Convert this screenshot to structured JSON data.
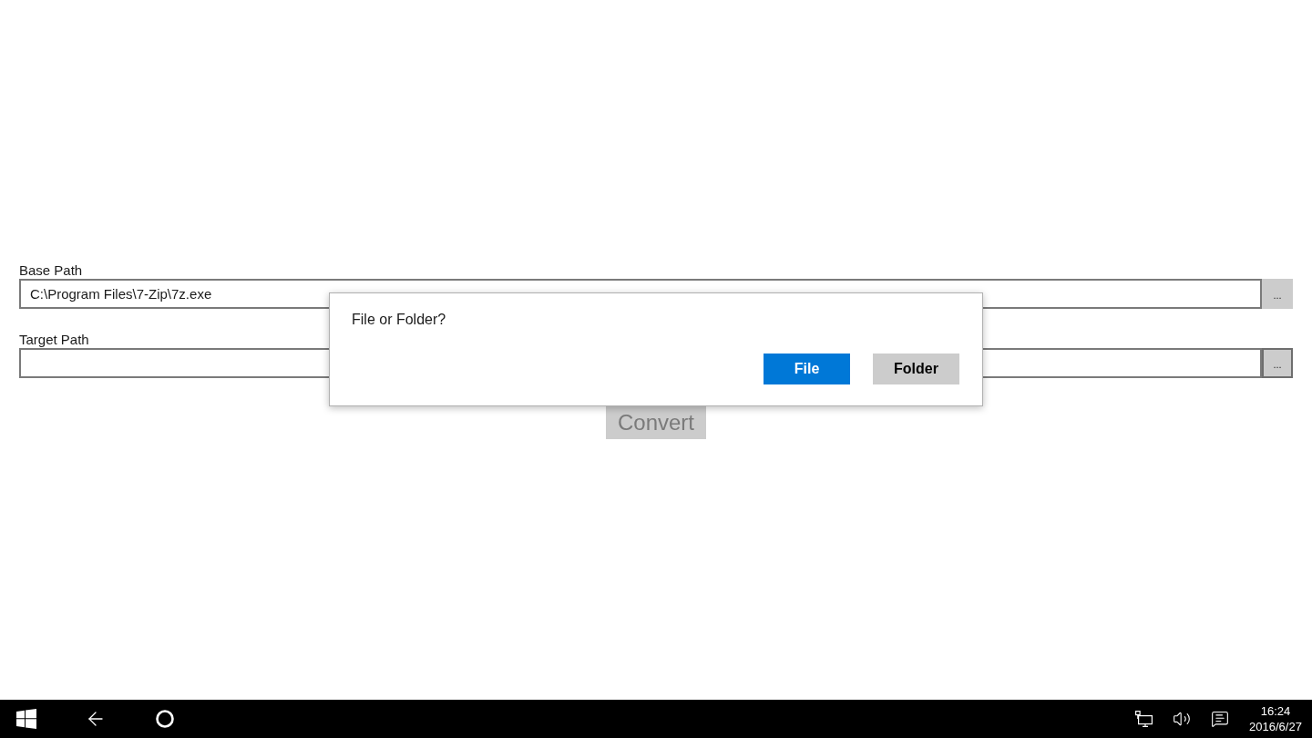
{
  "fields": [
    {
      "label": "Base Path",
      "value": "C:\\Program Files\\7-Zip\\7z.exe",
      "browse_button": {
        "label": "...",
        "focused": false
      }
    },
    {
      "label": "Target Path",
      "browse_button": {
        "label": "...",
        "focused": true
      }
    }
  ],
  "convert_button": {
    "label": "Convert",
    "disabled": true
  },
  "dialog": {
    "message": "File or Folder?",
    "buttons": [
      {
        "label": "File",
        "kind": "primary"
      },
      {
        "label": "Folder",
        "kind": "secondary"
      }
    ]
  },
  "taskbar": {
    "clock": {
      "time": "16:24",
      "date": "2016/6/27"
    }
  }
}
